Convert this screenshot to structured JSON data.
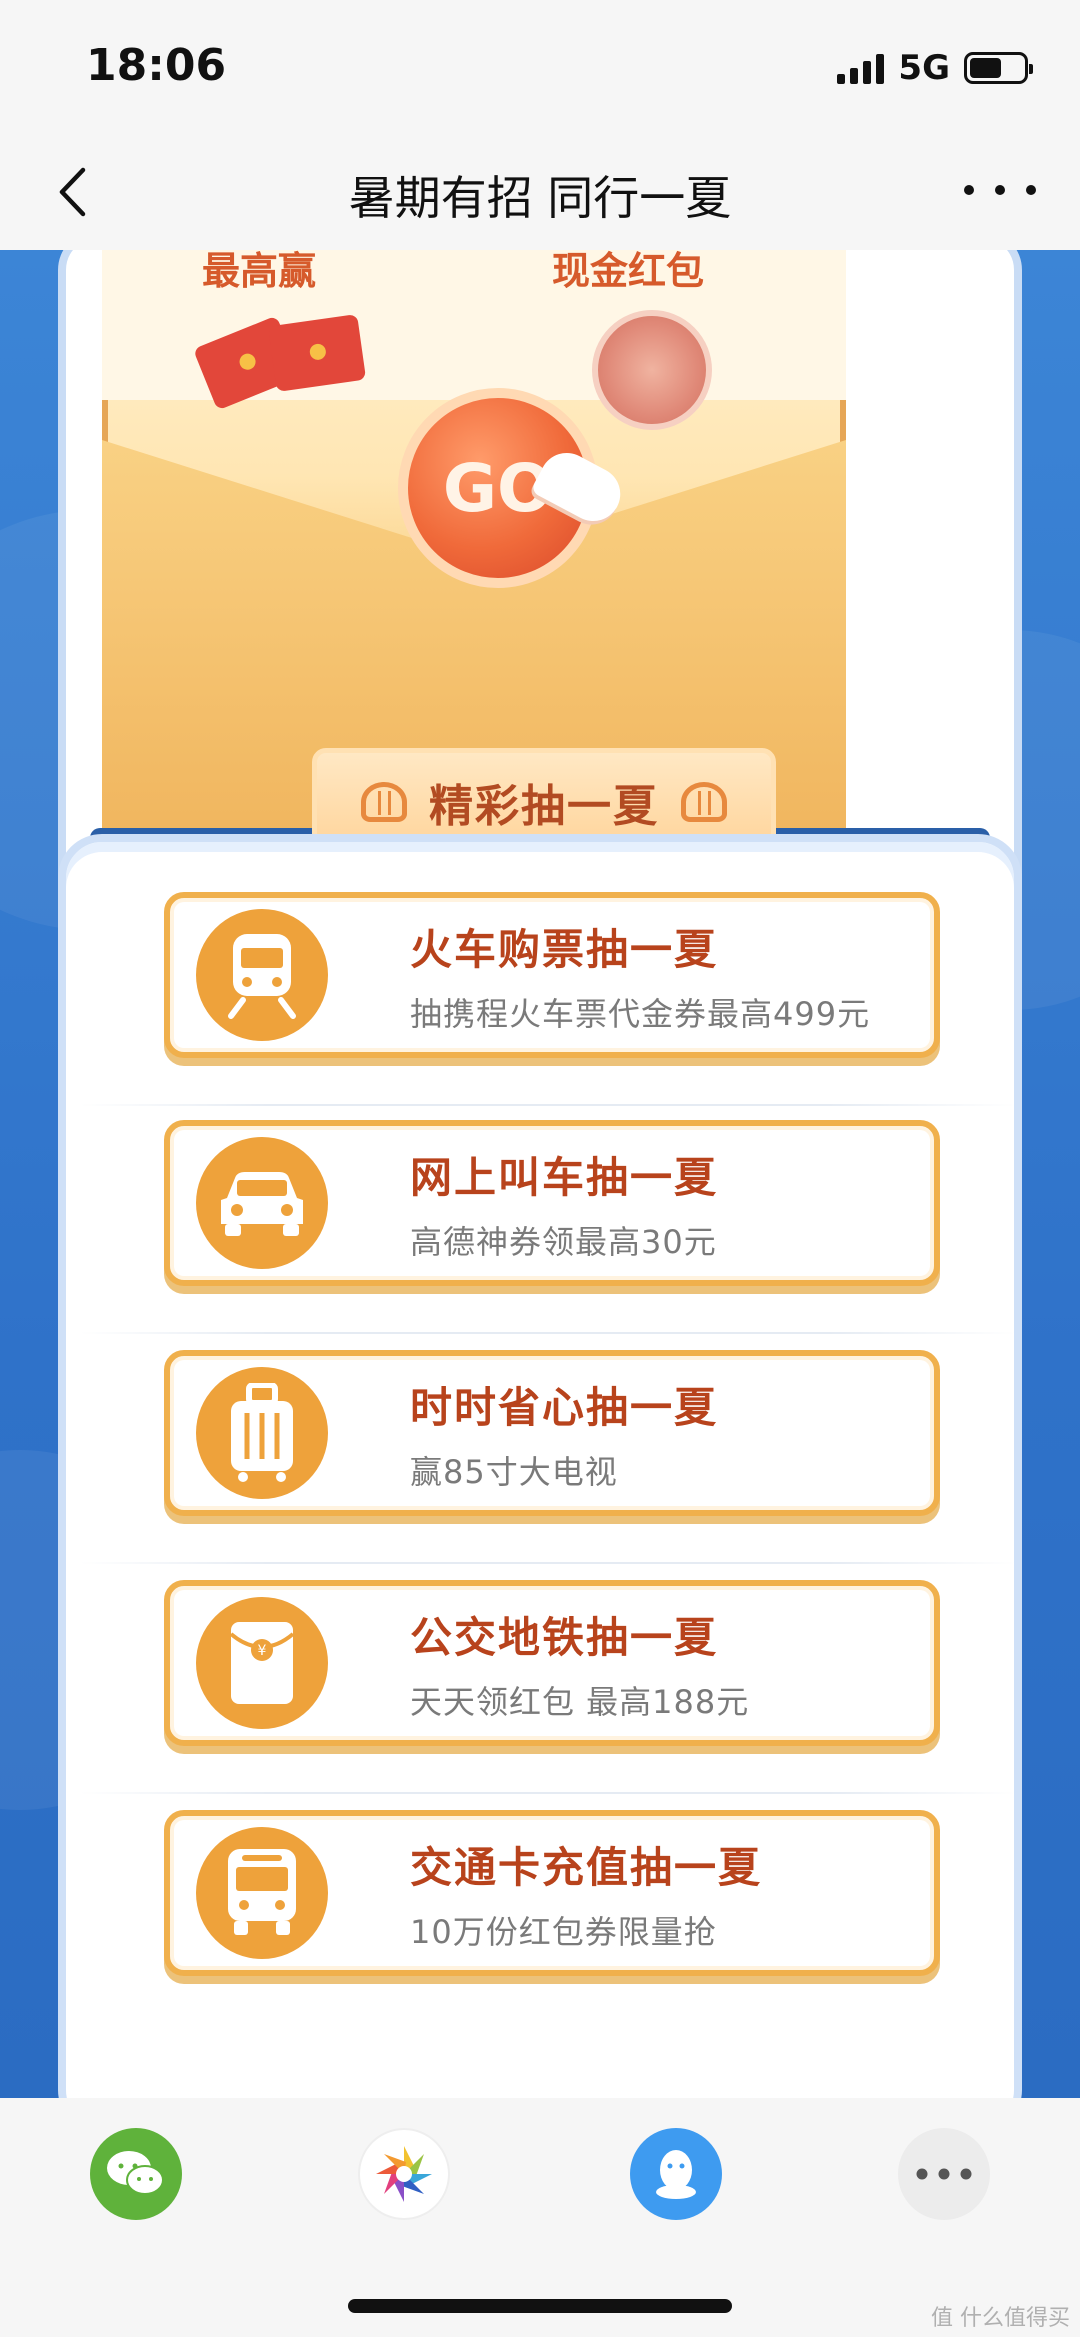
{
  "status_bar": {
    "time": "18:06",
    "network": "5G",
    "battery_level": 0.6
  },
  "nav": {
    "title": "暑期有招 同行一夏"
  },
  "banner": {
    "caption_left": "最高赢",
    "caption_right": "现金红包",
    "go_label": "GO"
  },
  "section_tab": {
    "label": "精彩抽一夏"
  },
  "items": [
    {
      "title": "火车购票抽一夏",
      "subtitle": "抽携程火车票代金券最高499元",
      "icon": "train-icon"
    },
    {
      "title": "网上叫车抽一夏",
      "subtitle": "高德神券领最高30元",
      "icon": "car-icon"
    },
    {
      "title": "时时省心抽一夏",
      "subtitle": "赢85寸大电视",
      "icon": "suitcase-icon"
    },
    {
      "title": "公交地铁抽一夏",
      "subtitle": "天天领红包 最高188元",
      "icon": "red-envelope-icon"
    },
    {
      "title": "交通卡充值抽一夏",
      "subtitle": "10万份红包券限量抢",
      "icon": "bus-icon"
    }
  ],
  "share_bar": {
    "buttons": [
      "wechat-icon",
      "moments-icon",
      "qq-icon",
      "more-icon"
    ]
  },
  "watermark": "值 什么值得买",
  "colors": {
    "accent": "#eea23b",
    "title": "#b8431c",
    "background": "#2f72c9"
  }
}
